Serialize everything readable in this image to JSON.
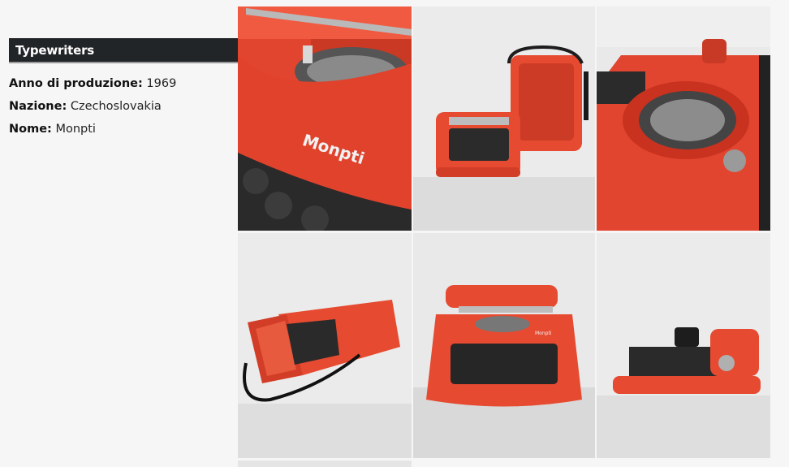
{
  "section": {
    "title": "Typewriters"
  },
  "details": [
    {
      "label": "Anno di produzione:",
      "value": "1969"
    },
    {
      "label": "Nazione:",
      "value": "Czechoslovakia"
    },
    {
      "label": "Nome:",
      "value": "Monpti"
    }
  ],
  "gallery": {
    "brand_text": "Monpti",
    "photos": [
      "typewriter-closeup",
      "typewriter-with-case",
      "typewriter-top-detail",
      "typewriter-in-case",
      "typewriter-front",
      "typewriter-side"
    ]
  },
  "colors": {
    "accent": "#e23f2a",
    "header_bg": "#222528"
  }
}
